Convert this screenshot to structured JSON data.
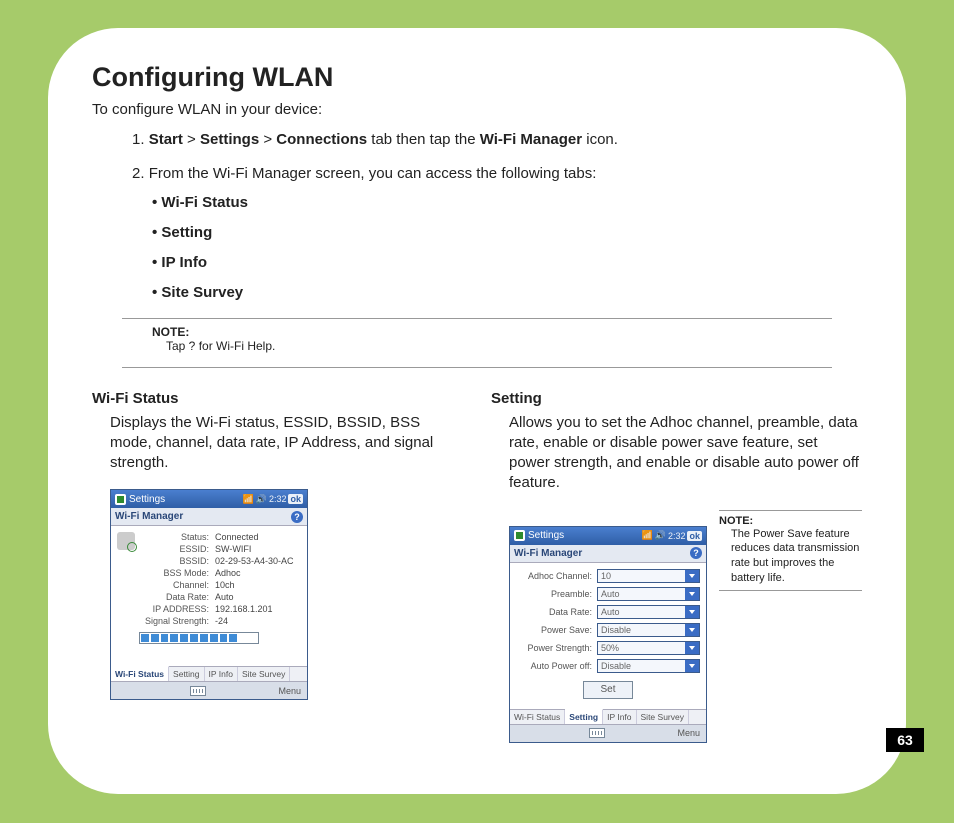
{
  "title": "Configuring WLAN",
  "intro": "To configure WLAN in your device:",
  "step1": {
    "num": "1. ",
    "b1": "Start",
    "sep": " > ",
    "b2": "Settings",
    "b3": "Connections",
    "mid": " tab then tap the ",
    "b4": "Wi-Fi Manager",
    "tail": " icon."
  },
  "step2": {
    "num": "2. ",
    "text": "From the Wi-Fi Manager screen, you can access the following tabs:"
  },
  "bullets": [
    "Wi-Fi Status",
    "Setting",
    "IP Info",
    "Site Survey"
  ],
  "note1": {
    "head": "NOTE:",
    "body": "Tap ? for Wi-Fi Help."
  },
  "left": {
    "head": "Wi-Fi Status",
    "body": "Displays the Wi-Fi status, ESSID, BSSID, BSS mode, channel, data rate, IP Address, and signal strength."
  },
  "right": {
    "head": "Setting",
    "body": "Allows you to set the Adhoc channel, preamble, data rate, enable or disable power save feature, set power strength, and enable or disable auto power off feature."
  },
  "note2": {
    "head": "NOTE:",
    "body": "The Power Save feature reduces data transmission rate but improves the battery life."
  },
  "page_number": "63",
  "phone": {
    "title": "Settings",
    "sub": "Wi-Fi Manager",
    "tray_time": "2:32",
    "tabs": [
      "Wi-Fi Status",
      "Setting",
      "IP Info",
      "Site Survey"
    ],
    "soft_right": "Menu",
    "status": {
      "rows": [
        {
          "k": "Status:",
          "v": "Connected"
        },
        {
          "k": "ESSID:",
          "v": "SW-WIFI"
        },
        {
          "k": "BSSID:",
          "v": "02-29-53-A4-30-AC"
        },
        {
          "k": "BSS Mode:",
          "v": "Adhoc"
        },
        {
          "k": "Channel:",
          "v": "10ch"
        },
        {
          "k": "Data Rate:",
          "v": "Auto"
        },
        {
          "k": "IP ADDRESS:",
          "v": "192.168.1.201"
        },
        {
          "k": "Signal Strength:",
          "v": "-24"
        }
      ]
    },
    "setting": {
      "rows": [
        {
          "k": "Adhoc Channel:",
          "v": "10"
        },
        {
          "k": "Preamble:",
          "v": "Auto"
        },
        {
          "k": "Data Rate:",
          "v": "Auto"
        },
        {
          "k": "Power Save:",
          "v": "Disable"
        },
        {
          "k": "Power Strength:",
          "v": "50%"
        },
        {
          "k": "Auto Power off:",
          "v": "Disable"
        }
      ],
      "button": "Set"
    }
  }
}
